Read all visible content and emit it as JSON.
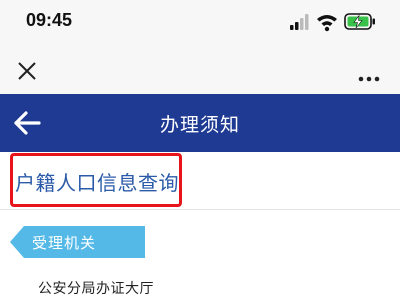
{
  "status_bar": {
    "time": "09:45",
    "icons": [
      "signal-icon",
      "wifi-icon",
      "battery-charging-icon"
    ]
  },
  "browser_bar": {
    "close_icon": "close-icon",
    "more_icon": "more-icon"
  },
  "header": {
    "title": "办理须知",
    "back_icon": "back-arrow-icon",
    "background_color": "#1f3a93"
  },
  "query": {
    "title": "户籍人口信息查询",
    "highlight_color": "#e8141c",
    "text_color": "#2a5aa8"
  },
  "section": {
    "label": "受理机关",
    "tag_color": "#55b9e8",
    "office": "公安分局办证大厅"
  }
}
